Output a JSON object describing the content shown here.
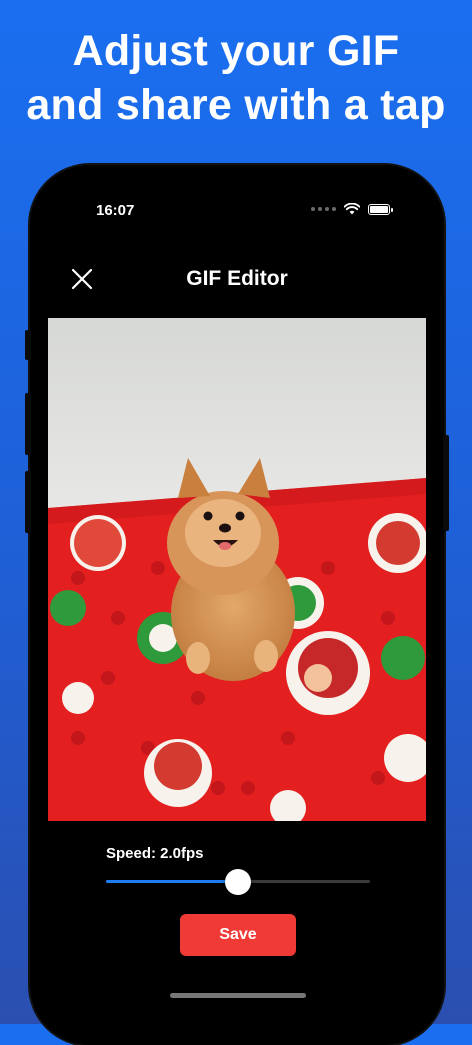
{
  "headline": {
    "line1": "Adjust your GIF",
    "line2": "and share with a tap"
  },
  "status_bar": {
    "time": "16:07",
    "icons": [
      "signal-dots-icon",
      "wifi-icon",
      "battery-icon"
    ]
  },
  "editor": {
    "title": "GIF Editor",
    "close_icon": "close-icon",
    "speed_label": "Speed: 2.0fps",
    "speed_fraction": 0.5,
    "save_label": "Save"
  },
  "colors": {
    "background_top": "#1a6ff0",
    "accent": "#1e7cf2",
    "save_button": "#f03a36",
    "phone": "#000000"
  }
}
